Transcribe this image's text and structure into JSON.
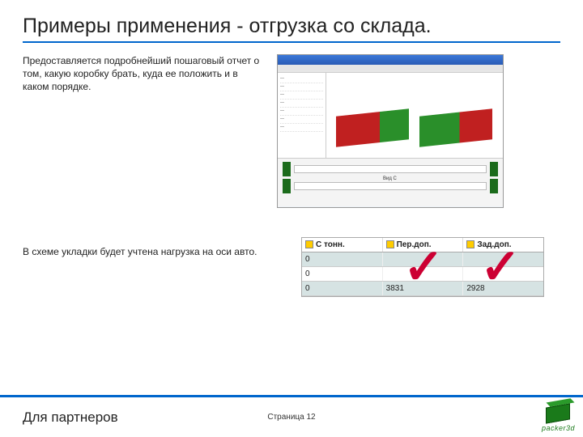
{
  "title": "Примеры применения - отгрузка со склада.",
  "paragraph1": "Предоставляется подробнейший пошаговый отчет о том, какую коробку брать, куда ее положить и в каком порядке.",
  "paragraph2": "В схеме укладки будет учтена нагрузка на оси авто.",
  "axle_table": {
    "headers": [
      "С тонн.",
      "Пер.доп.",
      "Зад.доп."
    ],
    "rows": [
      [
        "0",
        "",
        ""
      ],
      [
        "0",
        "",
        ""
      ],
      [
        "0",
        "3831",
        "2928"
      ]
    ]
  },
  "footer": {
    "left": "Для партнеров",
    "page": "Страница 12",
    "brand": "packer3d"
  },
  "app_thumb": {
    "caption": "Вид С"
  }
}
